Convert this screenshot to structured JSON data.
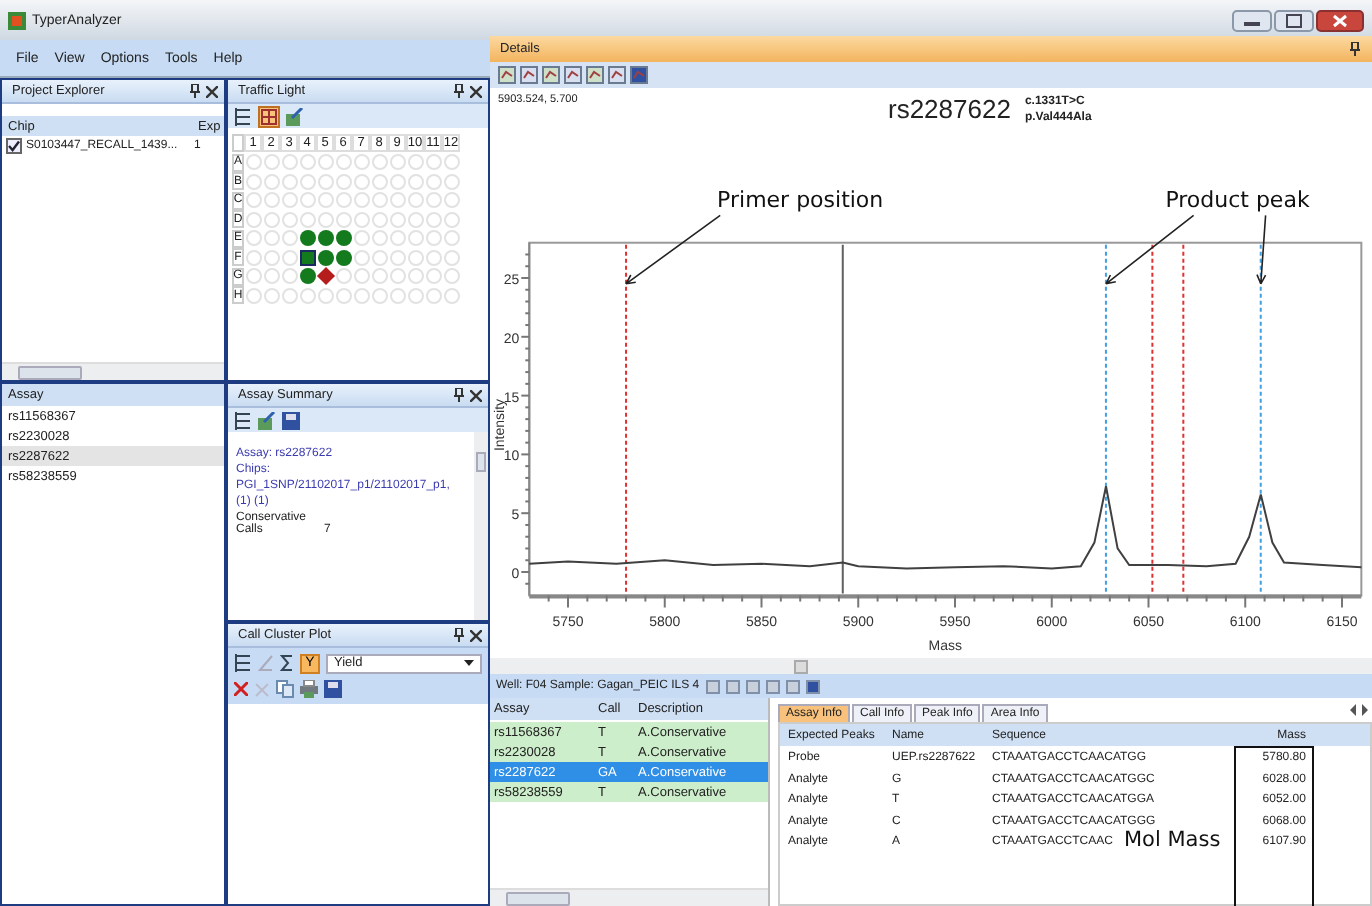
{
  "window": {
    "title": "TyperAnalyzer"
  },
  "menu": [
    "File",
    "View",
    "Options",
    "Tools",
    "Help"
  ],
  "project_explorer": {
    "title": "Project Explorer",
    "columns": [
      "Chip",
      "Exp"
    ],
    "rows": [
      {
        "chip": "S0103447_RECALL_1439...",
        "exp": "1",
        "checked": true
      }
    ]
  },
  "assay_list": {
    "title": "Assay",
    "items": [
      {
        "label": "rs11568367",
        "selected": false
      },
      {
        "label": "rs2230028",
        "selected": false
      },
      {
        "label": "rs2287622",
        "selected": true
      },
      {
        "label": "rs58238559",
        "selected": false
      }
    ]
  },
  "traffic_light": {
    "title": "Traffic Light",
    "columns": [
      "1",
      "2",
      "3",
      "4",
      "5",
      "6",
      "7",
      "8",
      "9",
      "10",
      "11",
      "12"
    ],
    "rows": [
      {
        "label": "A",
        "wells": [
          {
            "kind": "empty",
            "selected": false
          },
          {
            "kind": "empty",
            "selected": false
          },
          {
            "kind": "empty",
            "selected": false
          },
          {
            "kind": "empty",
            "selected": false
          },
          {
            "kind": "empty",
            "selected": false
          },
          {
            "kind": "empty",
            "selected": false
          },
          {
            "kind": "empty",
            "selected": false
          },
          {
            "kind": "empty",
            "selected": false
          },
          {
            "kind": "empty",
            "selected": false
          },
          {
            "kind": "empty",
            "selected": false
          },
          {
            "kind": "empty",
            "selected": false
          },
          {
            "kind": "empty",
            "selected": false
          }
        ]
      },
      {
        "label": "B",
        "wells": [
          {
            "kind": "empty",
            "selected": false
          },
          {
            "kind": "empty",
            "selected": false
          },
          {
            "kind": "empty",
            "selected": false
          },
          {
            "kind": "empty",
            "selected": false
          },
          {
            "kind": "empty",
            "selected": false
          },
          {
            "kind": "empty",
            "selected": false
          },
          {
            "kind": "empty",
            "selected": false
          },
          {
            "kind": "empty",
            "selected": false
          },
          {
            "kind": "empty",
            "selected": false
          },
          {
            "kind": "empty",
            "selected": false
          },
          {
            "kind": "empty",
            "selected": false
          },
          {
            "kind": "empty",
            "selected": false
          }
        ]
      },
      {
        "label": "C",
        "wells": [
          {
            "kind": "empty",
            "selected": false
          },
          {
            "kind": "empty",
            "selected": false
          },
          {
            "kind": "empty",
            "selected": false
          },
          {
            "kind": "empty",
            "selected": false
          },
          {
            "kind": "empty",
            "selected": false
          },
          {
            "kind": "empty",
            "selected": false
          },
          {
            "kind": "empty",
            "selected": false
          },
          {
            "kind": "empty",
            "selected": false
          },
          {
            "kind": "empty",
            "selected": false
          },
          {
            "kind": "empty",
            "selected": false
          },
          {
            "kind": "empty",
            "selected": false
          },
          {
            "kind": "empty",
            "selected": false
          }
        ]
      },
      {
        "label": "D",
        "wells": [
          {
            "kind": "empty",
            "selected": false
          },
          {
            "kind": "empty",
            "selected": false
          },
          {
            "kind": "empty",
            "selected": false
          },
          {
            "kind": "empty",
            "selected": false
          },
          {
            "kind": "empty",
            "selected": false
          },
          {
            "kind": "empty",
            "selected": false
          },
          {
            "kind": "empty",
            "selected": false
          },
          {
            "kind": "empty",
            "selected": false
          },
          {
            "kind": "empty",
            "selected": false
          },
          {
            "kind": "empty",
            "selected": false
          },
          {
            "kind": "empty",
            "selected": false
          },
          {
            "kind": "empty",
            "selected": false
          }
        ]
      },
      {
        "label": "E",
        "wells": [
          {
            "kind": "empty",
            "selected": false
          },
          {
            "kind": "empty",
            "selected": false
          },
          {
            "kind": "empty",
            "selected": false
          },
          {
            "kind": "pass",
            "selected": false
          },
          {
            "kind": "pass",
            "selected": false
          },
          {
            "kind": "pass",
            "selected": false
          },
          {
            "kind": "empty",
            "selected": false
          },
          {
            "kind": "empty",
            "selected": false
          },
          {
            "kind": "empty",
            "selected": false
          },
          {
            "kind": "empty",
            "selected": false
          },
          {
            "kind": "empty",
            "selected": false
          },
          {
            "kind": "empty",
            "selected": false
          }
        ]
      },
      {
        "label": "F",
        "wells": [
          {
            "kind": "empty",
            "selected": false
          },
          {
            "kind": "empty",
            "selected": false
          },
          {
            "kind": "empty",
            "selected": false
          },
          {
            "kind": "pass",
            "selected": true
          },
          {
            "kind": "pass",
            "selected": false
          },
          {
            "kind": "pass",
            "selected": false
          },
          {
            "kind": "empty",
            "selected": false
          },
          {
            "kind": "empty",
            "selected": false
          },
          {
            "kind": "empty",
            "selected": false
          },
          {
            "kind": "empty",
            "selected": false
          },
          {
            "kind": "empty",
            "selected": false
          },
          {
            "kind": "empty",
            "selected": false
          }
        ]
      },
      {
        "label": "G",
        "wells": [
          {
            "kind": "empty",
            "selected": false
          },
          {
            "kind": "empty",
            "selected": false
          },
          {
            "kind": "empty",
            "selected": false
          },
          {
            "kind": "pass",
            "selected": false
          },
          {
            "kind": "fail",
            "selected": false
          },
          {
            "kind": "empty",
            "selected": false
          },
          {
            "kind": "empty",
            "selected": false
          },
          {
            "kind": "empty",
            "selected": false
          },
          {
            "kind": "empty",
            "selected": false
          },
          {
            "kind": "empty",
            "selected": false
          },
          {
            "kind": "empty",
            "selected": false
          },
          {
            "kind": "empty",
            "selected": false
          }
        ]
      },
      {
        "label": "H",
        "wells": [
          {
            "kind": "empty",
            "selected": false
          },
          {
            "kind": "empty",
            "selected": false
          },
          {
            "kind": "empty",
            "selected": false
          },
          {
            "kind": "empty",
            "selected": false
          },
          {
            "kind": "empty",
            "selected": false
          },
          {
            "kind": "empty",
            "selected": false
          },
          {
            "kind": "empty",
            "selected": false
          },
          {
            "kind": "empty",
            "selected": false
          },
          {
            "kind": "empty",
            "selected": false
          },
          {
            "kind": "empty",
            "selected": false
          },
          {
            "kind": "empty",
            "selected": false
          },
          {
            "kind": "empty",
            "selected": false
          }
        ]
      }
    ]
  },
  "assay_summary": {
    "title": "Assay Summary",
    "assay": "Assay: rs2287622",
    "chips_label": "Chips:",
    "chips": "PGI_1SNP/21102017_p1/21102017_p1,",
    "chip_counts": "(1) (1)",
    "conservative_label": "Conservative Calls",
    "conservative_value": "7"
  },
  "call_cluster_plot": {
    "title": "Call Cluster Plot",
    "y_button": "Y",
    "select": "Yield"
  },
  "details": {
    "title": "Details",
    "cursor": "5903.524, 5.700",
    "assay": "rs2287622",
    "cdna": "c.1331T>C",
    "protein": "p.Val444Ala",
    "chart_data": {
      "type": "line",
      "xlabel": "Mass",
      "ylabel": "Intensity",
      "xlim": [
        5730,
        6160
      ],
      "ylim": [
        -2,
        28
      ],
      "xticks": [
        5750,
        5800,
        5850,
        5900,
        5950,
        6000,
        6050,
        6100,
        6150
      ],
      "yticks": [
        0,
        5,
        10,
        15,
        20,
        25
      ],
      "x": [
        5730,
        5750,
        5775,
        5800,
        5825,
        5850,
        5875,
        5892,
        5900,
        5925,
        5950,
        5975,
        6000,
        6015,
        6022,
        6028,
        6034,
        6040,
        6060,
        6080,
        6095,
        6102,
        6108,
        6114,
        6120,
        6140,
        6160
      ],
      "series": [
        {
          "color": "#404040",
          "values": [
            0.7,
            0.9,
            0.7,
            1.0,
            0.6,
            0.7,
            0.5,
            0.8,
            0.5,
            0.3,
            0.4,
            0.5,
            0.3,
            0.5,
            2.5,
            7.3,
            2.0,
            0.6,
            0.6,
            0.5,
            0.7,
            3.0,
            6.6,
            2.5,
            0.8,
            0.6,
            0.4
          ]
        }
      ],
      "ref_lines": [
        {
          "axis": "x",
          "value": 5780,
          "color": "#e03030"
        },
        {
          "axis": "x",
          "value": 5892,
          "color": "#606060"
        },
        {
          "axis": "x",
          "value": 6028,
          "color": "#40a0e0"
        },
        {
          "axis": "x",
          "value": 6052,
          "color": "#e03030"
        },
        {
          "axis": "x",
          "value": 6068,
          "color": "#e03030"
        },
        {
          "axis": "x",
          "value": 6108,
          "color": "#40a0e0"
        }
      ],
      "annotations": [
        "Primer position",
        "Product peak"
      ]
    }
  },
  "well_bar": {
    "label": "Well: F04 Sample: Gagan_PEIC ILS 4"
  },
  "call_table": {
    "columns": [
      "Assay",
      "Call",
      "Description"
    ],
    "rows": [
      {
        "cells": [
          "rs11568367",
          "T",
          "A.Conservative"
        ],
        "selected": false
      },
      {
        "cells": [
          "rs2230028",
          "T",
          "A.Conservative"
        ],
        "selected": false
      },
      {
        "cells": [
          "rs2287622",
          "GA",
          "A.Conservative"
        ],
        "selected": true
      },
      {
        "cells": [
          "rs58238559",
          "T",
          "A.Conservative"
        ],
        "selected": false
      }
    ]
  },
  "info_tabs": [
    {
      "label": "Assay Info",
      "selected": true
    },
    {
      "label": "Call Info",
      "selected": false
    },
    {
      "label": "Peak Info",
      "selected": false
    },
    {
      "label": "Area Info",
      "selected": false
    }
  ],
  "peaks_table": {
    "columns": [
      "Expected Peaks",
      "Name",
      "Sequence",
      "Mass"
    ],
    "rows": [
      [
        "Probe",
        "UEP.rs2287622",
        "CTAAATGACCTCAACATGG",
        "5780.80"
      ],
      [
        "Analyte",
        "G",
        "CTAAATGACCTCAACATGGC",
        "6028.00"
      ],
      [
        "Analyte",
        "T",
        "CTAAATGACCTCAACATGGA",
        "6052.00"
      ],
      [
        "Analyte",
        "C",
        "CTAAATGACCTCAACATGGG",
        "6068.00"
      ],
      [
        "Analyte",
        "A",
        "CTAAATGACCTCAAC",
        "6107.90"
      ]
    ]
  },
  "callout": {
    "label": "Mol Mass"
  }
}
